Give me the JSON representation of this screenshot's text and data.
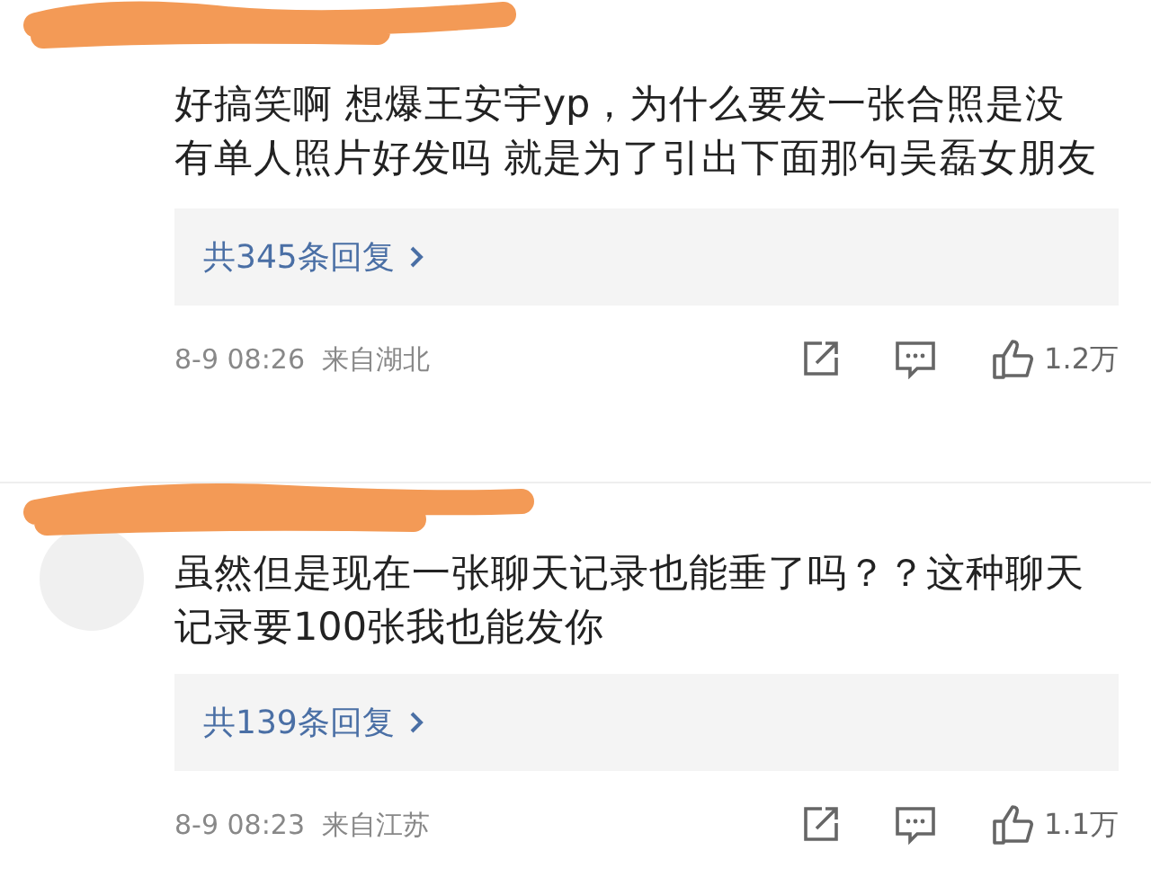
{
  "comments": [
    {
      "text": "好搞笑啊 想爆王安宇yp，为什么要发一张合照是没有单人照片好发吗 就是为了引出下面那句吴磊女朋友",
      "replies": "共345条回复",
      "date": "8-9 08:26",
      "location": "来自湖北",
      "likes": "1.2万",
      "liked": false
    },
    {
      "text": "虽然但是现在一张聊天记录也能垂了吗？？这种聊天记录要100张我也能发你",
      "replies": "共139条回复",
      "date": "8-9 08:23",
      "location": "来自江苏",
      "likes": "1.1万",
      "liked": false
    }
  ]
}
